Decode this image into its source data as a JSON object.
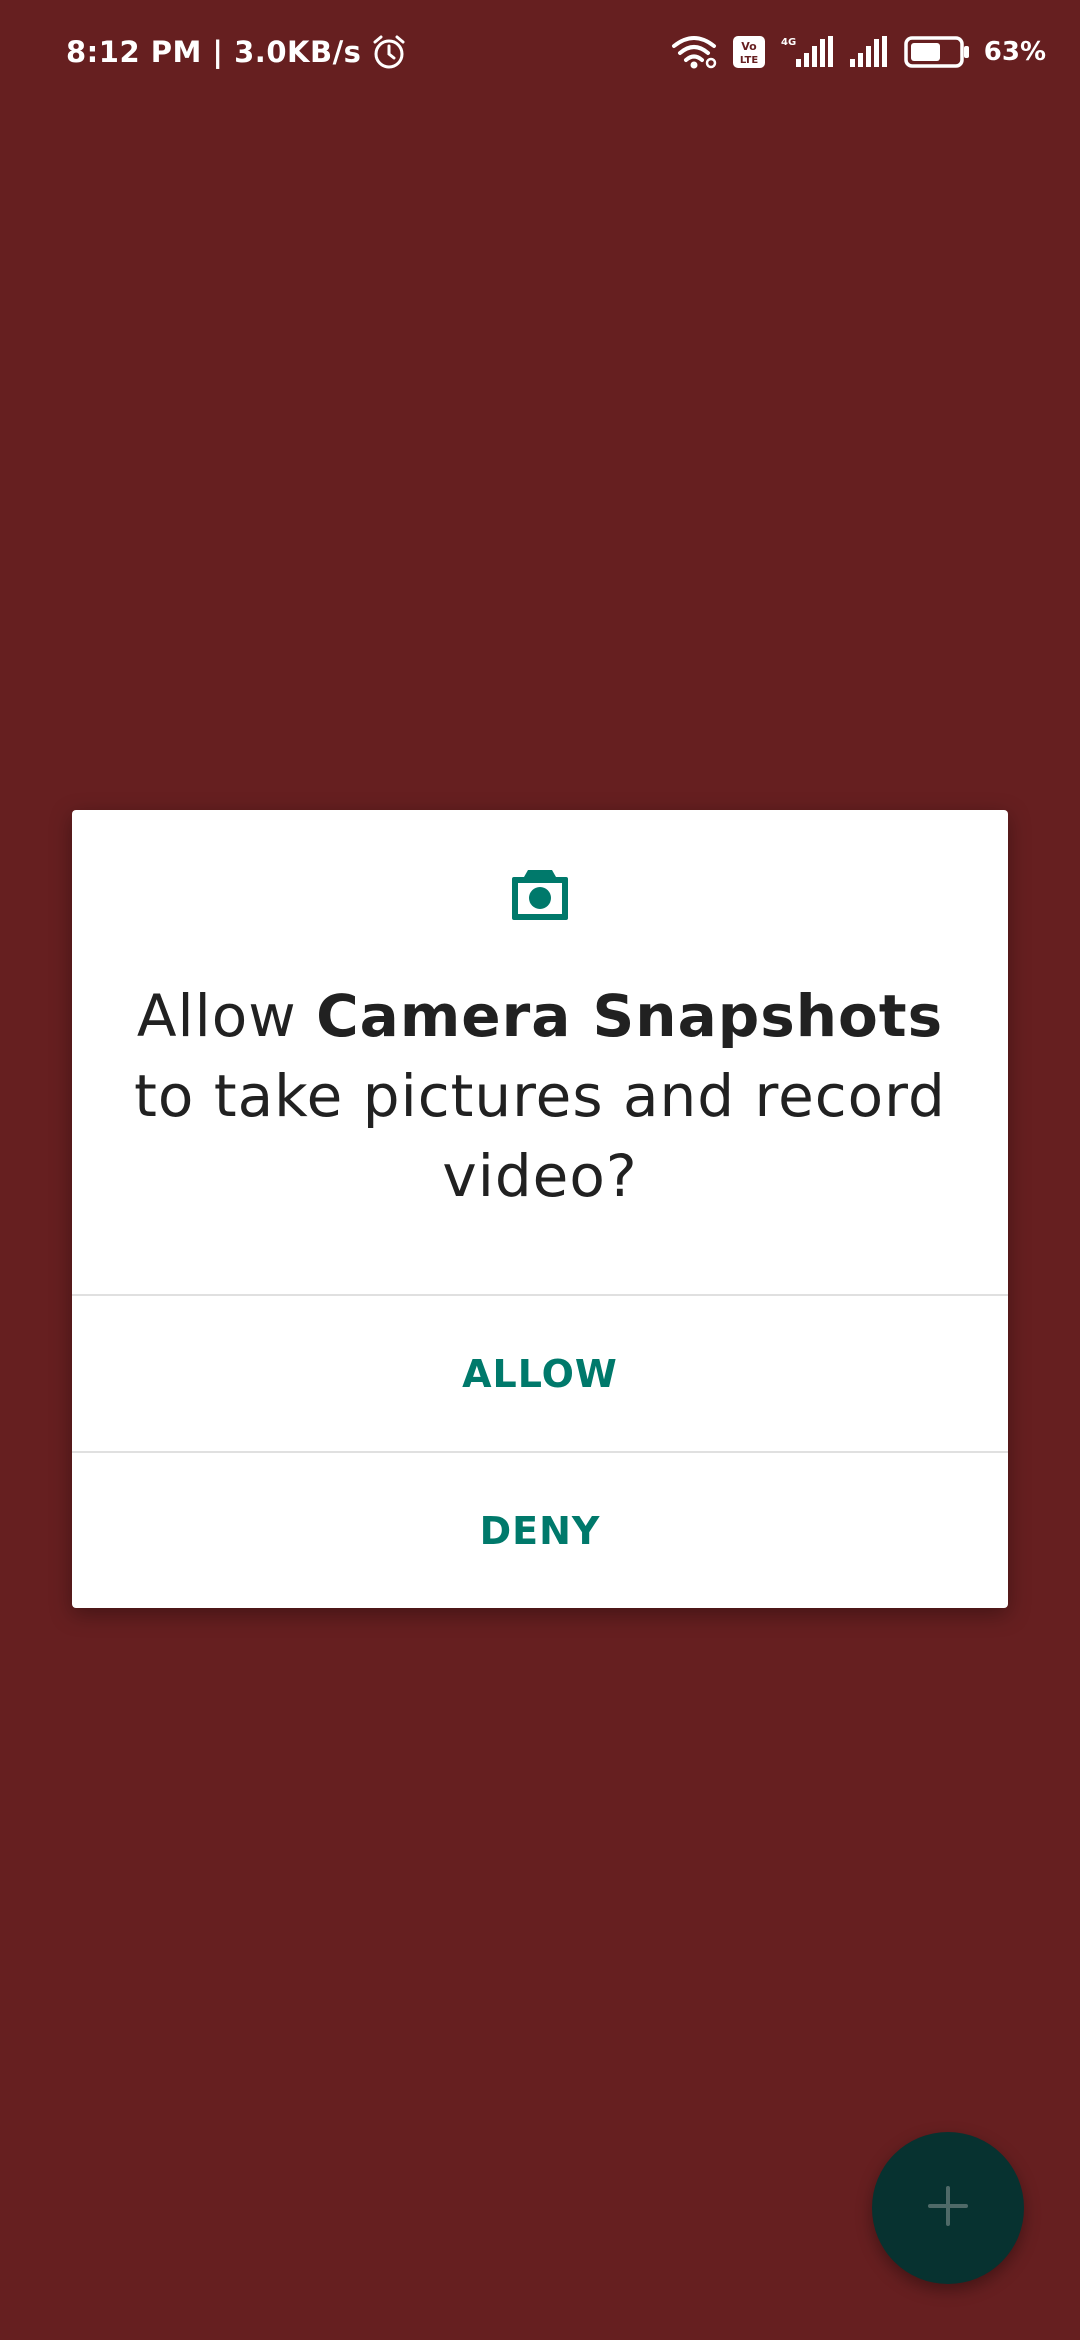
{
  "status_bar": {
    "time_speed": "8:12 PM | 3.0KB/s",
    "battery_percent": "63%",
    "battery_level": 0.63,
    "volte_label": "Vo LTE",
    "network_label": "4G",
    "icons": [
      "alarm-icon",
      "wifi-icon",
      "volte-icon",
      "signal-4g-icon",
      "signal-icon",
      "battery-icon"
    ]
  },
  "colors": {
    "background": "#661f20",
    "dialog_background": "#ffffff",
    "accent": "#00796b",
    "text": "#212121",
    "fab": "#073230"
  },
  "dialog": {
    "icon": "camera-icon",
    "message_prefix": "Allow ",
    "app_name": "Camera Snapshots",
    "message_suffix": " to take pictures and record video?",
    "allow_label": "ALLOW",
    "deny_label": "DENY"
  },
  "fab": {
    "icon": "plus-icon"
  }
}
